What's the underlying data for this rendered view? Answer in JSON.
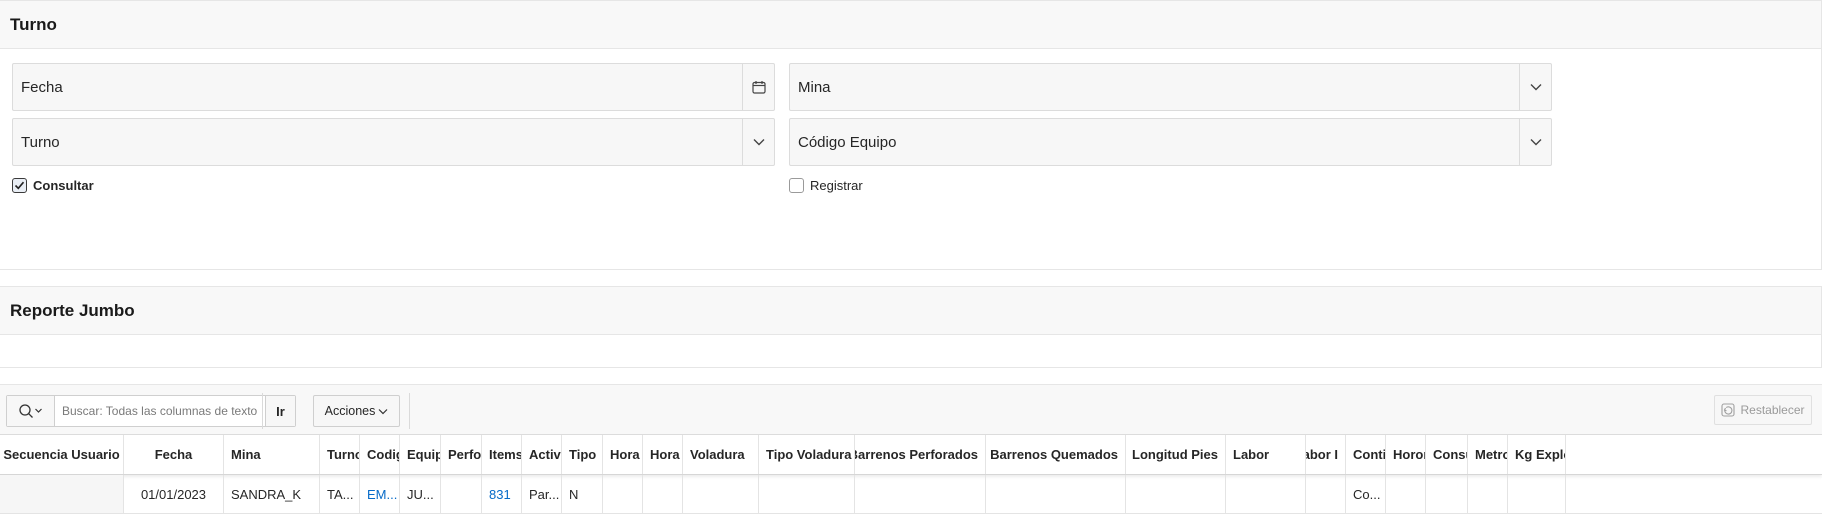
{
  "turno_region": {
    "title": "Turno",
    "fields": {
      "fecha_label": "Fecha",
      "mina_label": "Mina",
      "turno_label": "Turno",
      "codigo_equipo_label": "Código Equipo"
    },
    "checks": {
      "consultar_label": "Consultar",
      "consultar_checked": true,
      "registrar_label": "Registrar",
      "registrar_checked": false
    }
  },
  "reporte_region": {
    "title": "Reporte Jumbo"
  },
  "toolbar": {
    "search_placeholder": "Buscar: Todas las columnas de texto",
    "go_label": "Ir",
    "actions_label": "Acciones",
    "reset_label": "Restablecer"
  },
  "grid": {
    "columns": [
      "Secuencia Usuario",
      "Fecha",
      "Mina",
      "Turno...",
      "Codigo",
      "Equipo",
      "Perfori",
      "Items...",
      "Activid",
      "Tipo",
      "Hora In",
      "Hora F",
      "Voladura",
      "Tipo Voladura",
      "Barrenos Perforados",
      "Barrenos Quemados",
      "Longitud Pies",
      "Labor",
      "Labor I",
      "Contin",
      "Horom",
      "Consu",
      "Metros",
      "Kg Explos"
    ],
    "rows": [
      [
        "",
        "01/01/2023",
        "SANDRA_K",
        "TA...",
        "EM...",
        "JU...",
        "",
        "831",
        "Par...",
        "N",
        "",
        "",
        "",
        "",
        "",
        "",
        "",
        "",
        "",
        "Co...",
        "",
        "",
        "",
        ""
      ]
    ]
  },
  "icons": {
    "calendar": "calendar-icon",
    "chevron": "chevron-down-icon",
    "search": "search-icon",
    "reset": "reset-icon"
  }
}
